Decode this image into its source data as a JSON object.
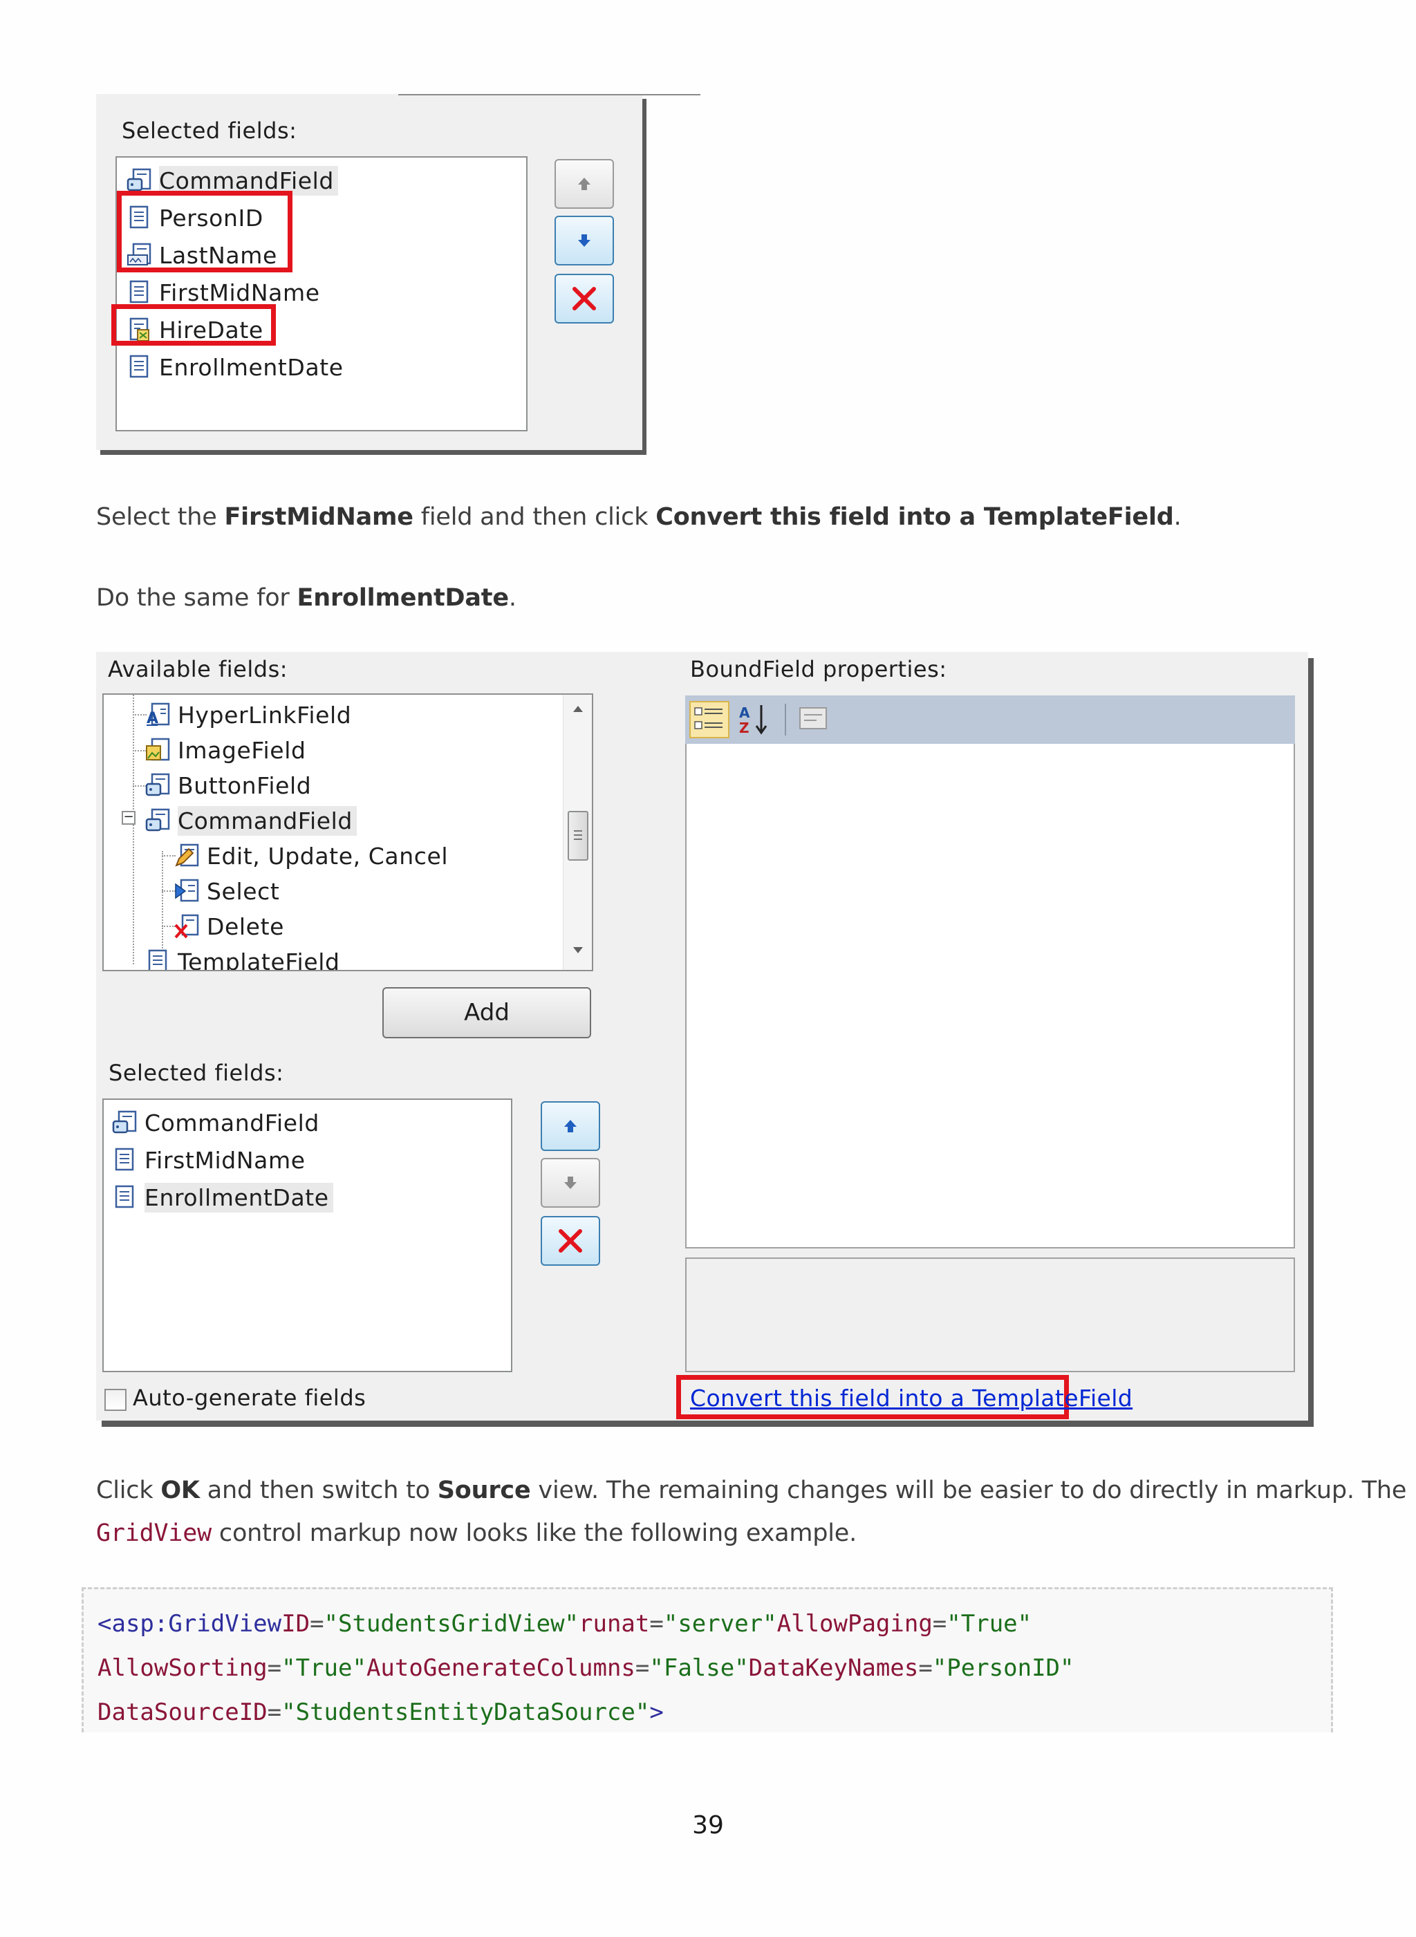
{
  "screenshot1": {
    "selected_fields_label": "Selected fields:",
    "fields": [
      "CommandField",
      "PersonID",
      "LastName",
      "FirstMidName",
      "HireDate",
      "EnrollmentDate"
    ]
  },
  "paragraph1": {
    "t1": "Select the ",
    "b1": "FirstMidName",
    "t2": " field and then click ",
    "b2": "Convert this field into a TemplateField",
    "t3": "."
  },
  "paragraph2": {
    "t1": "Do the same for ",
    "b1": "EnrollmentDate",
    "t2": "."
  },
  "screenshot2": {
    "available_fields_label": "Available fields:",
    "tree_items": [
      "HyperLinkField",
      "ImageField",
      "ButtonField",
      "CommandField",
      "Edit, Update, Cancel",
      "Select",
      "Delete",
      "TemplateField"
    ],
    "add_button": "Add",
    "selected_fields_label": "Selected fields:",
    "selected_fields": [
      "CommandField",
      "FirstMidName",
      "EnrollmentDate"
    ],
    "auto_generate_label": "Auto-generate fields",
    "properties_label": "BoundField properties:",
    "convert_link": "Convert this field into a TemplateField"
  },
  "paragraph3": {
    "t1": "Click ",
    "b1": "OK",
    "t2": " and then switch to ",
    "b2": "Source",
    "t3": " view. The remaining changes will be easier to do directly in markup. The",
    "code": "GridView",
    "t4": " control markup now looks like the following example."
  },
  "code": {
    "l1_tag": "<asp:GridView",
    "l1_a1": "ID",
    "l1_v1": "\"StudentsGridView\"",
    "l1_a2": "runat",
    "l1_v2": "\"server\"",
    "l1_a3": "AllowPaging",
    "l1_v3": "\"True\"",
    "l2_a1": "AllowSorting",
    "l2_v1": "\"True\"",
    "l2_a2": "AutoGenerateColumns",
    "l2_v2": "\"False\"",
    "l2_a3": "DataKeyNames",
    "l2_v3": "\"PersonID\"",
    "l3_a1": "DataSourceID",
    "l3_v1": "\"StudentsEntityDataSource\"",
    "l3_end": ">",
    "eq": "="
  },
  "page_number": "39",
  "colors": {
    "highlight_red": "#e3141d",
    "link_blue": "#0026d4",
    "code_attr": "#8a1538",
    "code_value": "#1b6e1b",
    "code_tag": "#2e2e9e"
  }
}
